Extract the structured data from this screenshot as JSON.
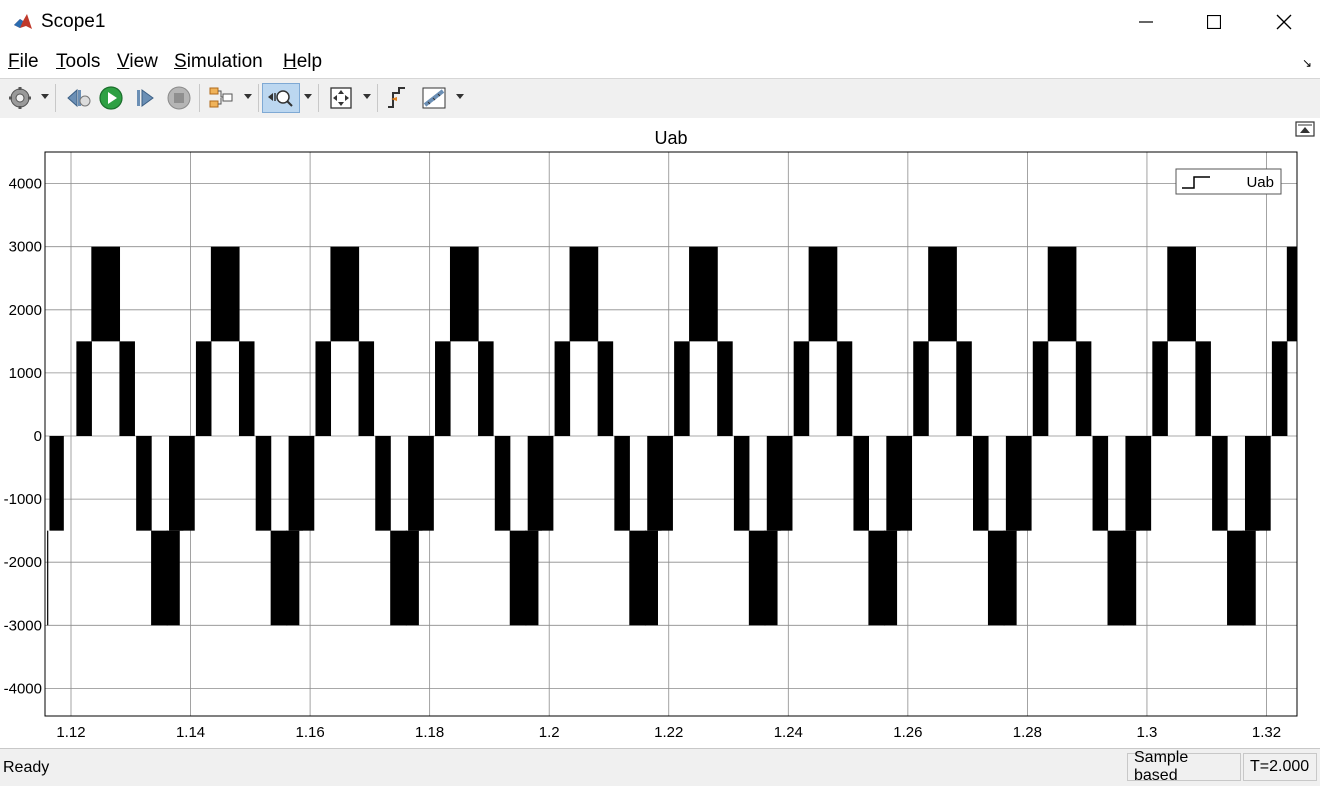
{
  "window": {
    "title": "Scope1"
  },
  "menu": [
    {
      "label": "File",
      "u": "F",
      "rest": "ile"
    },
    {
      "label": "Tools",
      "u": "T",
      "rest": "ools"
    },
    {
      "label": "View",
      "u": "V",
      "rest": "iew"
    },
    {
      "label": "Simulation",
      "u": "S",
      "rest": "imulation"
    },
    {
      "label": "Help",
      "u": "H",
      "rest": "elp"
    }
  ],
  "toolbar": [
    "settings-icon",
    "step-back-icon",
    "run-icon",
    "step-forward-icon",
    "stop-icon",
    "signal-select-icon",
    "zoom-icon",
    "fit-axes-icon",
    "trigger-icon",
    "measure-icon"
  ],
  "colors": {
    "toolbar_bg": "#f0f0f0",
    "trace": "#000000",
    "run_green": "#2ea043",
    "zoom_active": "#bcd7f0"
  },
  "chart_data": {
    "type": "line",
    "title": "Uab",
    "xlabel": "",
    "ylabel": "",
    "xlim": [
      1.116,
      1.3255
    ],
    "ylim": [
      -4500,
      4500
    ],
    "x_ticks": [
      1.12,
      1.14,
      1.16,
      1.18,
      1.2,
      1.22,
      1.24,
      1.26,
      1.28,
      1.3,
      1.32
    ],
    "x_tick_labels": [
      "1.12",
      "1.14",
      "1.16",
      "1.18",
      "1.2",
      "1.22",
      "1.24",
      "1.26",
      "1.28",
      "1.3",
      "1.32"
    ],
    "y_ticks": [
      4000,
      3000,
      2000,
      1000,
      0,
      -1000,
      -2000,
      -3000,
      -4000
    ],
    "y_tick_labels": [
      "4000",
      "3000",
      "2000",
      "1000",
      "0",
      "-1000",
      "-2000",
      "-3000",
      "-4000"
    ],
    "grid": true,
    "legend": {
      "entries": [
        "Uab"
      ],
      "location": "top-right"
    },
    "series": [
      {
        "name": "Uab",
        "waveform": "multilevel PWM (dense switching)",
        "levels": [
          -3000,
          -1500,
          0,
          1500,
          3000
        ],
        "period": 0.02
      }
    ],
    "bands": [
      {
        "x0": 1.116,
        "x1": 1.1162,
        "lo": -3000,
        "hi": -1500
      },
      {
        "x0": 1.1164,
        "x1": 1.1188,
        "lo": -1500,
        "hi": 0
      },
      {
        "x0": 1.1209,
        "x1": 1.1235,
        "lo": 0,
        "hi": 1500
      },
      {
        "x0": 1.1234,
        "x1": 1.1282,
        "lo": 1500,
        "hi": 3000
      },
      {
        "x0": 1.1281,
        "x1": 1.1307,
        "lo": 0,
        "hi": 1500
      },
      {
        "x0": 1.1309,
        "x1": 1.1335,
        "lo": -1500,
        "hi": 0
      },
      {
        "x0": 1.1334,
        "x1": 1.1382,
        "lo": -3000,
        "hi": -1500
      },
      {
        "x0": 1.1381,
        "x1": 1.1407,
        "lo": -1500,
        "hi": 0
      }
    ],
    "status": {
      "left": "Ready",
      "mode": "Sample based",
      "time": "T=2.000"
    }
  }
}
